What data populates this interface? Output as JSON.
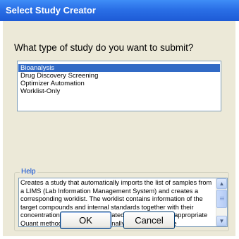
{
  "window": {
    "title": "Select Study Creator"
  },
  "question": "What type of study do you want to submit?",
  "study_types": [
    {
      "label": "Bioanalysis",
      "selected": true
    },
    {
      "label": "Drug Discovery Screening",
      "selected": false
    },
    {
      "label": "Optimizer Automation",
      "selected": false
    },
    {
      "label": "Worklist-Only",
      "selected": false
    }
  ],
  "help": {
    "legend": "Help",
    "text": "Creates a study that automatically imports the list of samples from a LIMS (Lab Information Management System) and creates a corresponding worklist. The worklist contains information of the target compounds and internal standards together with their concentration levels and associated level names. An appropriate Quant method is created. Optionally, the batch can be automatically analyzed and a"
  },
  "buttons": {
    "ok": "OK",
    "cancel": "Cancel"
  },
  "colors": {
    "titlebar": "#2a6fe6",
    "selection": "#316ac5",
    "dialog_bg": "#ece9d8",
    "legend": "#0046d5"
  },
  "icons": {
    "scroll_up": "up-arrow-icon",
    "scroll_down": "down-arrow-icon"
  }
}
